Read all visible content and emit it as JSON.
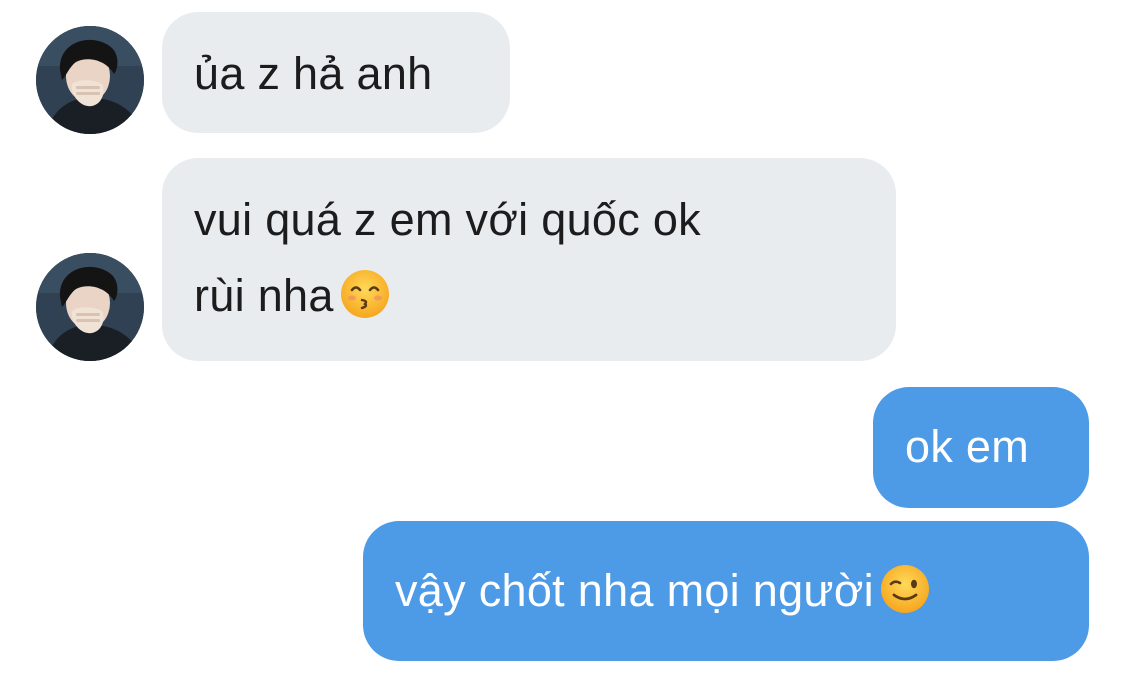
{
  "messages": [
    {
      "id": "m1",
      "side": "incoming",
      "text": "ủa z hả anh"
    },
    {
      "id": "m2",
      "side": "incoming",
      "lines": [
        "vui quá z em với quốc ok",
        "rùi nha"
      ],
      "emoji": "kissing-face-smiling-eyes-emoji"
    },
    {
      "id": "m3",
      "side": "outgoing",
      "text": "ok em"
    },
    {
      "id": "m4",
      "side": "outgoing",
      "text": "vậy chốt nha mọi người",
      "emoji": "winking-face-emoji"
    }
  ],
  "colors": {
    "incoming_bubble": "#e8ecef",
    "outgoing_bubble": "#4d9be6",
    "incoming_text": "#1c1c1c",
    "outgoing_text": "#ffffff"
  },
  "icons": {
    "avatar": "person-photo-avatar"
  }
}
